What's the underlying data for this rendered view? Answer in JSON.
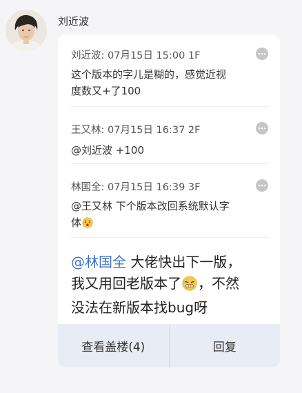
{
  "author": {
    "name": "刘近波"
  },
  "quotes": [
    {
      "header": "刘近波: 07月15日 15:00 1F",
      "line1": "这个版本的字儿是糊的，感觉近视",
      "line2": "度数又+了100",
      "menu_icon": "more-dots-icon"
    },
    {
      "header": "王又林: 07月15日 16:37 2F",
      "mention": "@刘近波",
      "text": " +100",
      "menu_icon": "more-dots-icon"
    },
    {
      "header": "林国全: 07月15日 16:39 3F",
      "mention": "@王又林",
      "line1": " 下个版本改回系统默认字",
      "line2": "体",
      "emoji": "surprised-face-emoji",
      "menu_icon": "more-dots-icon"
    }
  ],
  "reply": {
    "mention": "@林国全",
    "line1": " 大佬快出下一版，",
    "line2a": "我又用回老版本了",
    "line2b": "，不然",
    "line3": "没法在新版本找bug呀",
    "emoji": "grimacing-face-emoji"
  },
  "footer": {
    "view_thread_label": "查看盖楼(4)",
    "reply_label": "回复"
  },
  "colors": {
    "mention": "#3b73c9",
    "footer_bg": "#e8ecf5",
    "page_bg": "#f5f5f7"
  }
}
